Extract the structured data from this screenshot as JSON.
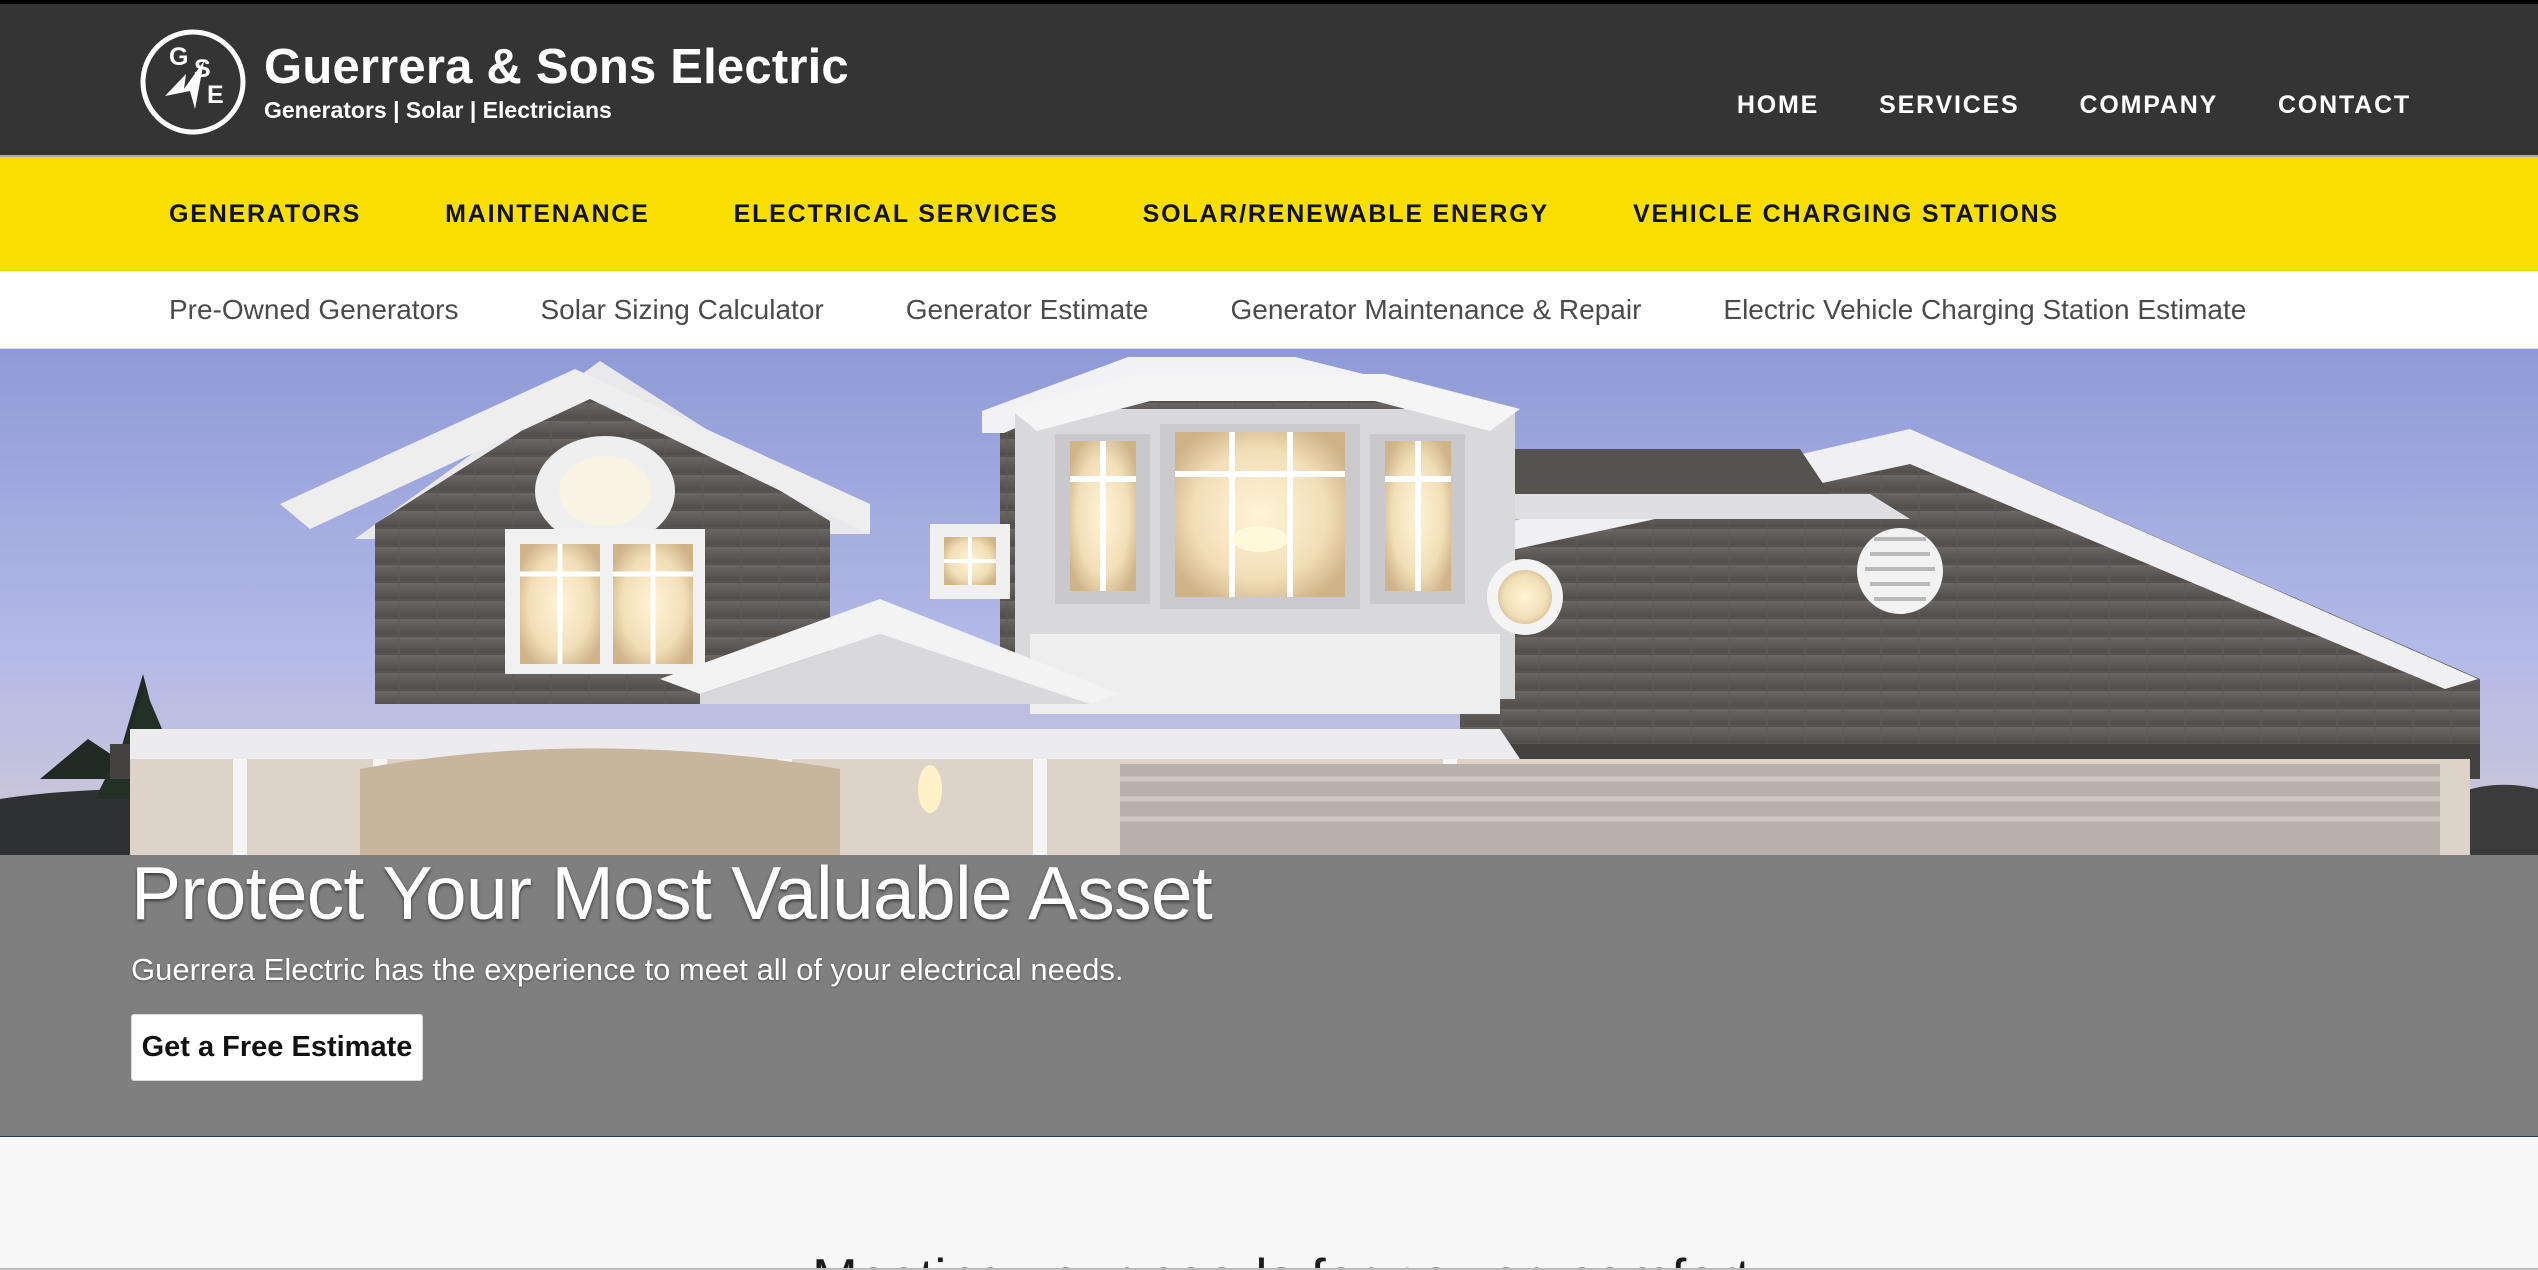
{
  "brand": {
    "logo_letters": {
      "g": "G",
      "s": "S",
      "e": "E"
    },
    "title": "Guerrera & Sons Electric",
    "subtitle": "Generators | Solar | Electricians"
  },
  "main_nav": [
    {
      "label": "HOME"
    },
    {
      "label": "SERVICES"
    },
    {
      "label": "COMPANY"
    },
    {
      "label": "CONTACT"
    }
  ],
  "category_nav": [
    {
      "label": "GENERATORS"
    },
    {
      "label": "MAINTENANCE"
    },
    {
      "label": "ELECTRICAL SERVICES"
    },
    {
      "label": "SOLAR/RENEWABLE ENERGY"
    },
    {
      "label": "VEHICLE CHARGING STATIONS"
    }
  ],
  "sub_nav": [
    {
      "label": "Pre-Owned Generators"
    },
    {
      "label": "Solar Sizing Calculator"
    },
    {
      "label": "Generator Estimate"
    },
    {
      "label": "Generator Maintenance & Repair"
    },
    {
      "label": "Electric Vehicle Charging Station Estimate"
    }
  ],
  "hero": {
    "title": "Protect Your Most Valuable Asset",
    "subtitle": "Guerrera Electric has the experience to meet all of your electrical needs.",
    "button_label": "Get a Free Estimate"
  },
  "below_section": {
    "heading": "Meeting your needs for power, comfort"
  },
  "colors": {
    "header": "#343434",
    "accent_yellow": "#fadf00",
    "hero_overlay": "#7f7f7f",
    "nav_text": "#ffffff",
    "category_text": "#111111",
    "subnav_text": "#4b4b4b"
  },
  "icons": {
    "logo": "gse-lightning-logo-icon"
  }
}
